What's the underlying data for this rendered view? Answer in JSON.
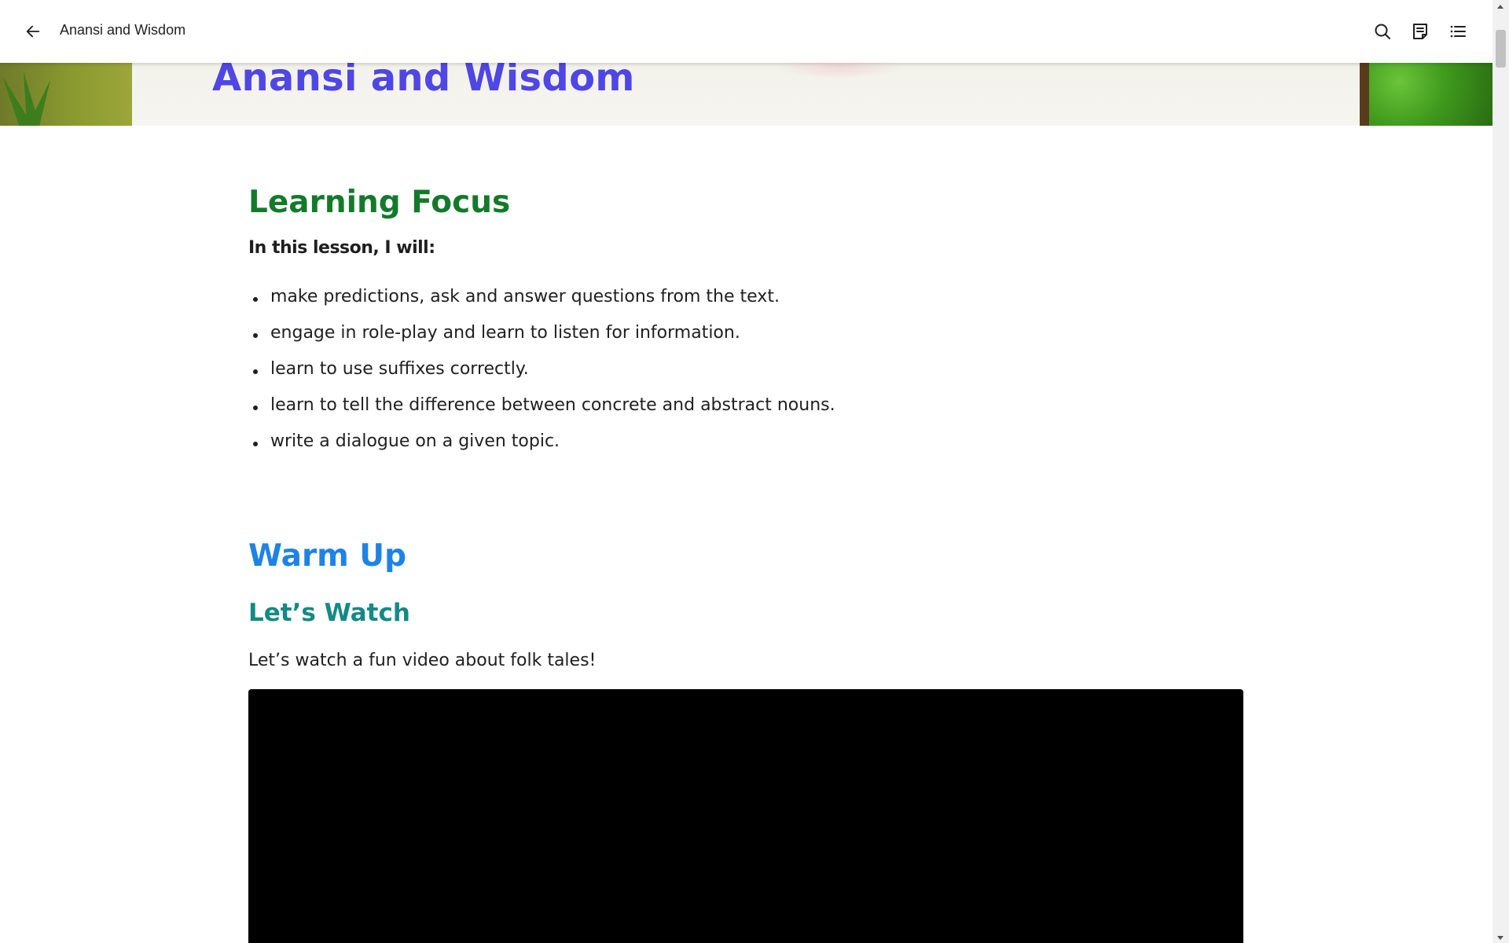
{
  "topbar": {
    "title": "Anansi and Wisdom",
    "icons": [
      "back-arrow-icon",
      "search-icon",
      "notes-icon",
      "table-of-contents-icon"
    ]
  },
  "banner": {
    "title": "Anansi and Wisdom"
  },
  "learning_focus": {
    "heading": "Learning Focus",
    "intro": "In this lesson, I will:",
    "items": [
      "make predictions, ask and answer questions from the text.",
      "engage in role-play and learn to listen for information.",
      "learn to use suffixes correctly.",
      "learn to tell the difference between concrete and abstract nouns.",
      "write a dialogue on a given topic."
    ]
  },
  "warm_up": {
    "heading": "Warm Up",
    "subheading": "Let’s Watch",
    "text": "Let’s watch a fun video about folk tales!"
  },
  "colors": {
    "title": "#4f46e5",
    "learning_focus": "#137a2a",
    "warm_up": "#1e83e6",
    "lets_watch": "#138a85",
    "video": "#000000"
  }
}
